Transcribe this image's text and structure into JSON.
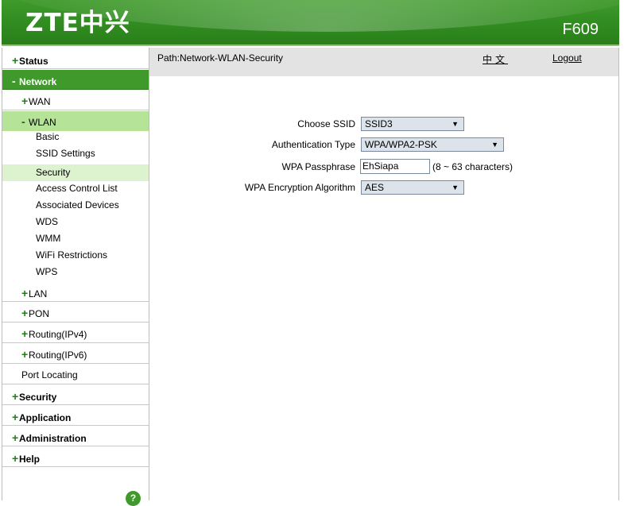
{
  "header": {
    "logo": "ZTE中兴",
    "model": "F609"
  },
  "menu": [
    {
      "label": "Status",
      "sign": "+"
    },
    {
      "label": "Network",
      "sign": "-"
    },
    {
      "label": "WAN",
      "sign": "+"
    },
    {
      "label": "WLAN",
      "sign": "-"
    },
    {
      "label": "Basic"
    },
    {
      "label": "SSID Settings"
    },
    {
      "label": "Security"
    },
    {
      "label": "Access Control List"
    },
    {
      "label": "Associated Devices"
    },
    {
      "label": "WDS"
    },
    {
      "label": "WMM"
    },
    {
      "label": "WiFi Restrictions"
    },
    {
      "label": "WPS"
    },
    {
      "label": "LAN",
      "sign": "+"
    },
    {
      "label": "PON",
      "sign": "+"
    },
    {
      "label": "Routing(IPv4)",
      "sign": "+"
    },
    {
      "label": "Routing(IPv6)",
      "sign": "+"
    },
    {
      "label": "Port Locating"
    },
    {
      "label": "Security",
      "sign": "+"
    },
    {
      "label": "Application",
      "sign": "+"
    },
    {
      "label": "Administration",
      "sign": "+"
    },
    {
      "label": "Help",
      "sign": "+"
    }
  ],
  "help_icon": "?",
  "topbar": {
    "path": "Path:Network-WLAN-Security",
    "language": "中文",
    "logout": "Logout"
  },
  "form": {
    "ssid_label": "Choose SSID",
    "ssid_value": "SSID3",
    "auth_label": "Authentication Type",
    "auth_value": "WPA/WPA2-PSK",
    "pass_label": "WPA Passphrase",
    "pass_value": "EhSiapa",
    "pass_hint": "(8 ~ 63 characters)",
    "enc_label": "WPA Encryption Algorithm",
    "enc_value": "AES"
  },
  "colors": {
    "brand_green": "#3f9a2b",
    "submenu_active": "#b5e397",
    "leaf_active": "#ddf2cf",
    "path_bar": "#e3e3e3"
  }
}
